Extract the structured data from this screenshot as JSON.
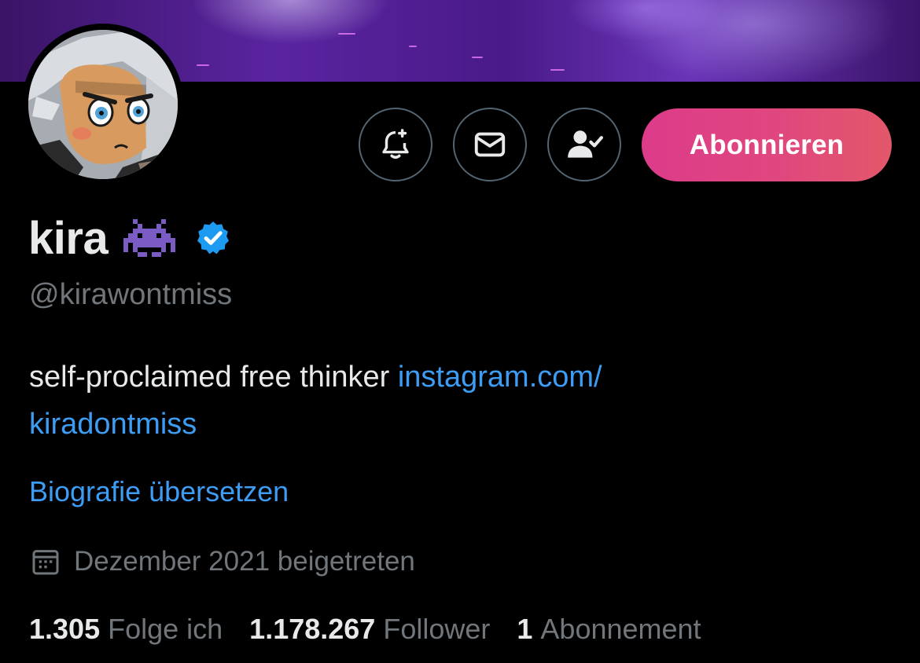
{
  "colors": {
    "background": "#000000",
    "primary_text": "#e7e9ea",
    "secondary_text": "#71767b",
    "link": "#3d9cf3",
    "verified": "#1d9bf0",
    "subscribe_gradient_start": "#dc3b8a",
    "subscribe_gradient_end": "#e2586a",
    "icon_button_border": "#536471"
  },
  "header": {
    "banner_image": "purple anime artwork banner",
    "avatar_image": "cartoon boy with white hair avatar"
  },
  "actions": {
    "notify_icon": "bell-plus-icon",
    "message_icon": "envelope-icon",
    "following_icon": "person-check-icon",
    "subscribe_label": "Abonnieren"
  },
  "profile": {
    "display_name": "kira",
    "name_emoji_icon": "alien-monster-icon",
    "verified_icon": "verified-badge-icon",
    "handle": "@kirawontmiss",
    "bio_text": "self-proclaimed free thinker ",
    "bio_link_line1": "instagram.com/",
    "bio_link_line2": "kiradontmiss",
    "translate_label": "Biografie übersetzen",
    "calendar_icon": "calendar-icon",
    "joined_text": "Dezember 2021 beigetreten"
  },
  "stats": {
    "following_count": "1.305",
    "following_label": "Folge ich",
    "followers_count": "1.178.267",
    "followers_label": "Follower",
    "subscriptions_count": "1",
    "subscriptions_label": "Abonnement"
  }
}
